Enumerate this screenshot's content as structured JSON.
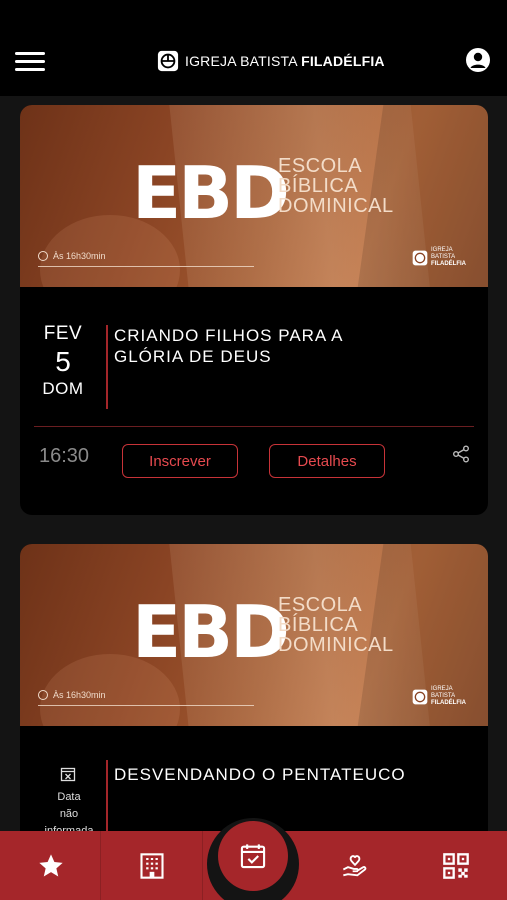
{
  "header": {
    "logo_text_regular": "IGREJA BATISTA ",
    "logo_text_bold": "FILADÉLFIA"
  },
  "events": [
    {
      "banner": {
        "title": "EBD",
        "subtitle_line1": "ESCOLA",
        "subtitle_line2": "BÍBLICA",
        "subtitle_line3": "DOMINICAL",
        "time_label": "Às 16h30min",
        "logo_line1": "IGREJA",
        "logo_line2": "BATISTA",
        "logo_line3": "FILADÉLFIA"
      },
      "month": "FEV",
      "day": "5",
      "weekday": "DOM",
      "title_line1": "CRIANDO FILHOS PARA A",
      "title_line2": "GLÓRIA DE DEUS",
      "time": "16:30",
      "register_label": "Inscrever",
      "details_label": "Detalhes"
    },
    {
      "banner": {
        "title": "EBD",
        "subtitle_line1": "ESCOLA",
        "subtitle_line2": "BÍBLICA",
        "subtitle_line3": "DOMINICAL",
        "time_label": "Às 16h30min",
        "logo_line1": "IGREJA",
        "logo_line2": "BATISTA",
        "logo_line3": "FILADÉLFIA"
      },
      "no_date_line1": "Data",
      "no_date_line2": "não",
      "no_date_line3": "informada",
      "title_line1": "DESVENDANDO O PENTATEUCO"
    }
  ],
  "bottom_nav": {
    "items": [
      "star-icon",
      "building-icon",
      "calendar-check-icon",
      "heart-hand-icon",
      "qr-code-icon"
    ],
    "accent_color": "#a5262a"
  }
}
